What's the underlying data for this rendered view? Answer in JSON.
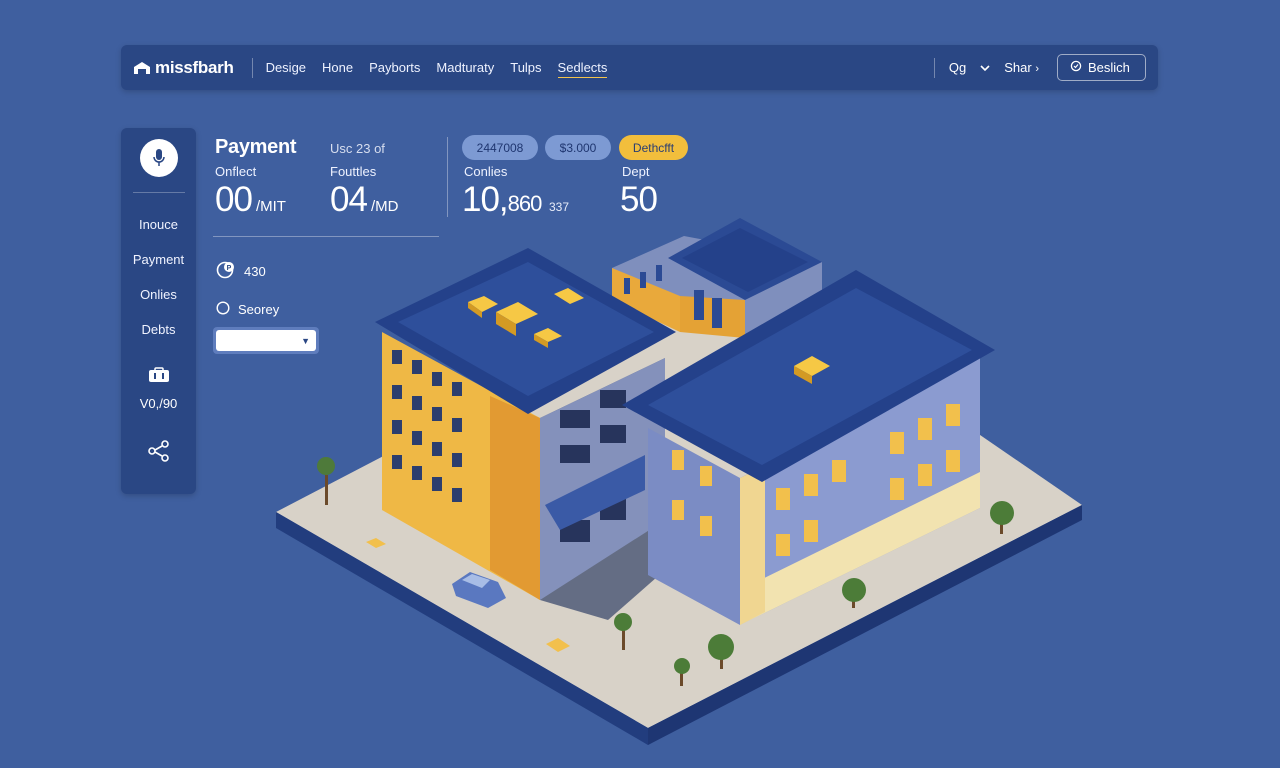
{
  "nav": {
    "brand": "missfbarh",
    "links": [
      "Desige",
      "Hone",
      "Payborts",
      "Madturaty",
      "Tulps",
      "Sedlects"
    ],
    "active_index": 5,
    "right_text": "Qg",
    "share": "Shar",
    "search_label": "Beslich"
  },
  "sidebar": {
    "items": [
      "Inouce",
      "Payment",
      "Onlies",
      "Debts"
    ],
    "value": "V0,/90"
  },
  "stats": {
    "title": "Payment",
    "subtitle": "Usc 23 of",
    "label_a": "Onflect",
    "value_a": "00",
    "unit_a": "/MIT",
    "label_b": "Fouttles",
    "value_b": "04",
    "unit_b": "/MD",
    "pill_1": "2447008",
    "pill_2": "$3.000",
    "pill_3": "Dethcfft",
    "label_c": "Conlies",
    "value_c": "10,",
    "value_c_tail": "860",
    "value_c_small": "337",
    "label_d": "Dept",
    "value_d": "50",
    "row_1": "430",
    "row_2": "Seorey"
  }
}
